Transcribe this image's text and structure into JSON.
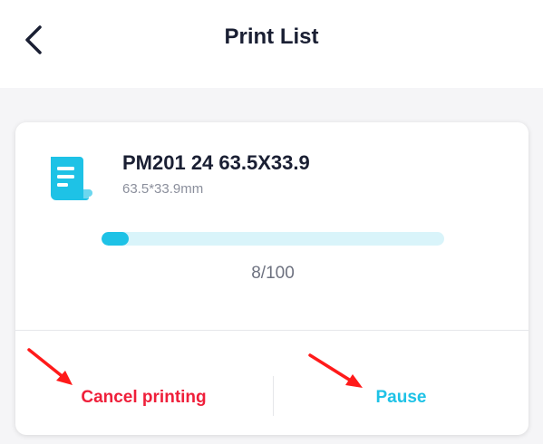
{
  "header": {
    "title": "Print List",
    "back_icon": "chevron-left-icon"
  },
  "job": {
    "icon": "document-icon",
    "title": "PM201 24 63.5X33.9",
    "size": "63.5*33.9mm",
    "progress_current": 8,
    "progress_total": 100,
    "progress_text": "8/100"
  },
  "actions": {
    "cancel_label": "Cancel printing",
    "pause_label": "Pause"
  },
  "colors": {
    "accent": "#1ec2e6",
    "progress_track": "#d9f4fa",
    "danger": "#ef1f3a",
    "annotation_arrow": "#ff1a1a"
  }
}
